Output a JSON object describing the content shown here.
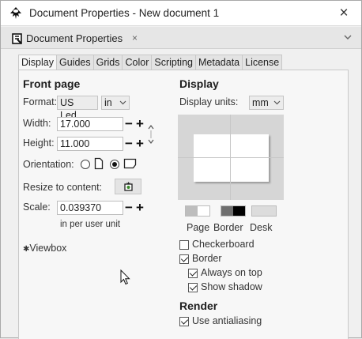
{
  "window": {
    "title": "Document Properties - New document 1",
    "close_glyph": "×",
    "app_icon": "inkscape-logo-icon"
  },
  "dock": {
    "tab_label": "Document Properties",
    "tab_close_glyph": "×",
    "tab_icon": "document-properties-icon",
    "menu_icon": "chevron-down-icon"
  },
  "tabs": [
    {
      "label": "Display",
      "active": true
    },
    {
      "label": "Guides",
      "active": false
    },
    {
      "label": "Grids",
      "active": false
    },
    {
      "label": "Color",
      "active": false
    },
    {
      "label": "Scripting",
      "active": false
    },
    {
      "label": "Metadata",
      "active": false
    },
    {
      "label": "License",
      "active": false
    }
  ],
  "front_page": {
    "heading": "Front page",
    "format_label": "Format:",
    "format_value": "US Led...",
    "unit_value": "in",
    "width_label": "Width:",
    "width_value": "17.000",
    "height_label": "Height:",
    "height_value": "11.000",
    "minus_glyph": "−",
    "plus_glyph": "+",
    "orientation_label": "Orientation:",
    "orientation_selected": "landscape",
    "resize_label": "Resize to content:",
    "scale_label": "Scale:",
    "scale_value": "0.039370",
    "scale_note": "in per user unit",
    "viewbox_label": "Viewbox",
    "viewbox_glyph": "✱"
  },
  "display": {
    "heading": "Display",
    "units_label": "Display units:",
    "units_value": "mm",
    "swatch_labels": [
      "Page",
      "Border",
      "Desk"
    ],
    "colors": {
      "page": "#ffffff",
      "border": "#000000",
      "desk": "#d6d6d6"
    },
    "checkerboard_label": "Checkerboard",
    "checkerboard": false,
    "border_label": "Border",
    "border": true,
    "always_on_top_label": "Always on top",
    "always_on_top": true,
    "show_shadow_label": "Show shadow",
    "show_shadow": true
  },
  "render": {
    "heading": "Render",
    "antialiasing_label": "Use antialiasing",
    "antialiasing": true
  }
}
